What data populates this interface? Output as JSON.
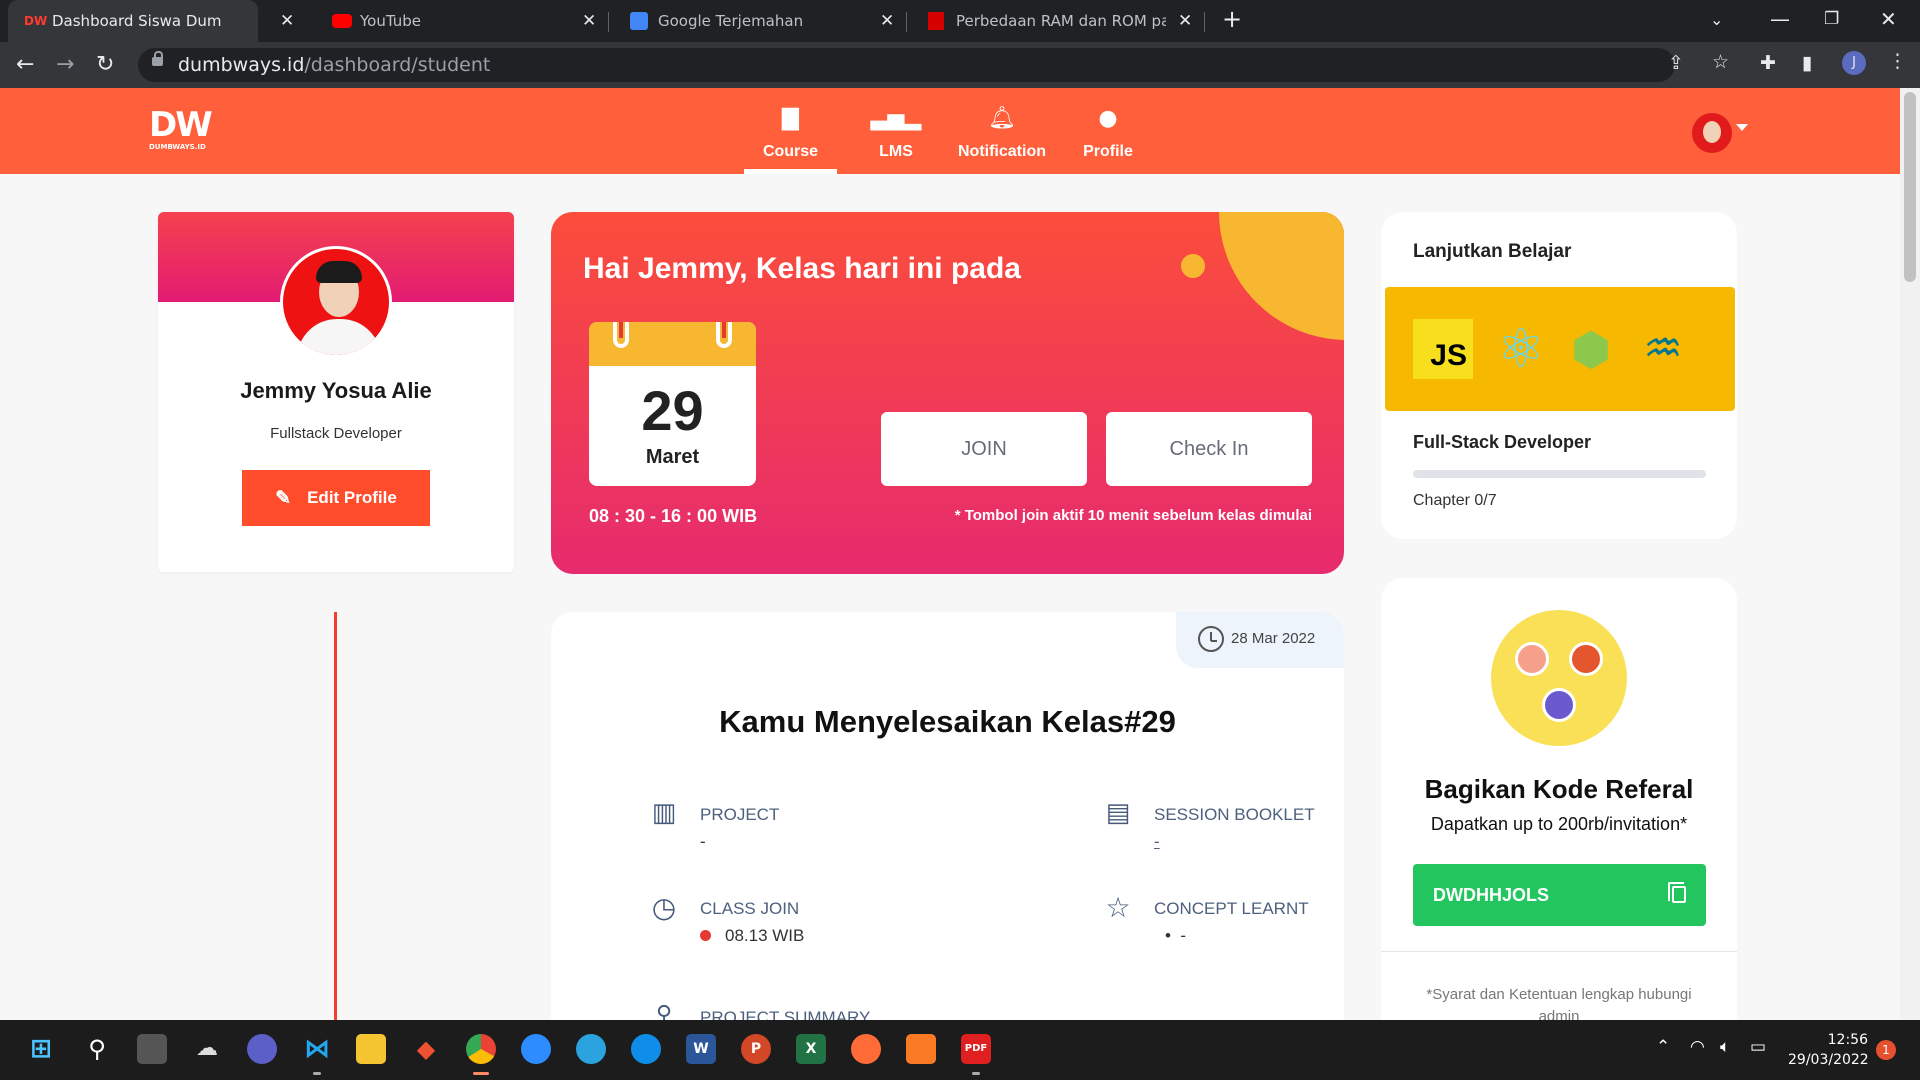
{
  "browser": {
    "tabs": [
      {
        "title": "Dashboard Siswa DumbWays.id |",
        "favicon": "dumbways-icon",
        "active": true
      },
      {
        "title": "YouTube",
        "favicon": "youtube-icon",
        "active": false
      },
      {
        "title": "Google Terjemahan",
        "favicon": "google-translate-icon",
        "active": false
      },
      {
        "title": "Perbedaan RAM dan ROM pada l",
        "favicon": "site-icon",
        "active": false
      }
    ],
    "url_host": "dumbways.id",
    "url_path": "/dashboard/student",
    "profile_initial": "J"
  },
  "header": {
    "logo_text": "DW",
    "logo_sub": "DUMBWAYS.ID",
    "nav": [
      {
        "label": "Course",
        "icon": "book-icon",
        "active": true
      },
      {
        "label": "LMS",
        "icon": "lms-icon",
        "active": false
      },
      {
        "label": "Notification",
        "icon": "bell-icon",
        "active": false
      },
      {
        "label": "Profile",
        "icon": "user-icon",
        "active": false
      }
    ]
  },
  "profile": {
    "name": "Jemmy Yosua Alie",
    "role": "Fullstack Developer",
    "edit_label": "Edit Profile"
  },
  "hero": {
    "greeting": "Hai Jemmy, Kelas hari ini pada",
    "day": "29",
    "month": "Maret",
    "time": "08 : 30 - 16 : 00 WIB",
    "join_label": "JOIN",
    "checkin_label": "Check In",
    "note": "* Tombol join aktif 10 menit sebelum kelas dimulai"
  },
  "class_card": {
    "date": "28 Mar 2022",
    "title": "Kamu Menyelesaikan Kelas#29",
    "project_label": "PROJECT",
    "project_value": "-",
    "booklet_label": "SESSION BOOKLET",
    "booklet_value": "-",
    "join_label": "CLASS JOIN",
    "join_value": "08.13 WIB",
    "concept_label": "CONCEPT LEARNT",
    "concept_value": "-",
    "summary_label": "PROJECT SUMMARY"
  },
  "learn": {
    "title": "Lanjutkan Belajar",
    "course": "Full-Stack Developer",
    "chapter": "Chapter 0/7",
    "progress": 0,
    "js_text": "JS",
    "banner_color": "#f6b800"
  },
  "referral": {
    "title": "Bagikan Kode Referal",
    "subtitle": "Dapatkan up to 200rb/invitation*",
    "code": "DWDHHJOLS",
    "terms": "*Syarat dan Ketentuan lengkap hubungi admin"
  },
  "taskbar": {
    "time": "12:56",
    "date": "29/03/2022",
    "badge": "1",
    "apps": [
      "start-icon",
      "search-icon",
      "task-view-icon",
      "onedrive-icon",
      "teams-icon",
      "vscode-icon",
      "file-explorer-icon",
      "git-icon",
      "chrome-icon",
      "zoom-icon",
      "telegram-icon",
      "teamviewer-icon",
      "word-icon",
      "powerpoint-icon",
      "excel-icon",
      "postman-icon",
      "xampp-icon",
      "pdf-icon"
    ]
  },
  "colors": {
    "brand": "#ff5f3a",
    "hero_top": "#fb4d3b",
    "hero_bottom": "#e62b6e",
    "accent_yellow": "#f7b731",
    "referral_green": "#22c55e"
  }
}
